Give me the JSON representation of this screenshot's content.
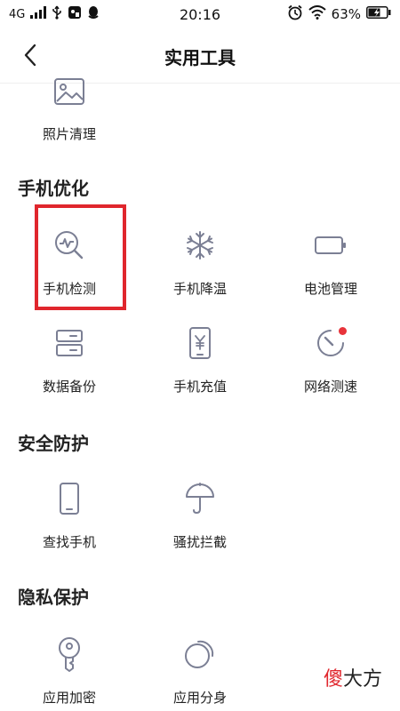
{
  "status_bar": {
    "network": "4G",
    "time": "20:16",
    "battery": "63%"
  },
  "header": {
    "title": "实用工具"
  },
  "sections": [
    {
      "title": "",
      "items": [
        {
          "label": "照片清理",
          "icon": "photo-icon"
        }
      ]
    },
    {
      "title": "手机优化",
      "items": [
        {
          "label": "手机检测",
          "icon": "phone-check-icon"
        },
        {
          "label": "手机降温",
          "icon": "snowflake-icon"
        },
        {
          "label": "电池管理",
          "icon": "battery-icon"
        },
        {
          "label": "数据备份",
          "icon": "backup-icon"
        },
        {
          "label": "手机充值",
          "icon": "phone-recharge-icon"
        },
        {
          "label": "网络测速",
          "icon": "speed-gauge-icon",
          "badge": "red-dot"
        }
      ]
    },
    {
      "title": "安全防护",
      "items": [
        {
          "label": "查找手机",
          "icon": "phone-icon"
        },
        {
          "label": "骚扰拦截",
          "icon": "umbrella-icon"
        }
      ]
    },
    {
      "title": "隐私保护",
      "items": [
        {
          "label": "应用加密",
          "icon": "key-lock-icon"
        },
        {
          "label": "应用分身",
          "icon": "app-clone-icon"
        }
      ]
    }
  ],
  "watermark": {
    "part1": "傻",
    "part2": "大方"
  },
  "colors": {
    "icon": "#7b7f94",
    "highlight": "#e0262d",
    "badge": "#e8333a"
  }
}
